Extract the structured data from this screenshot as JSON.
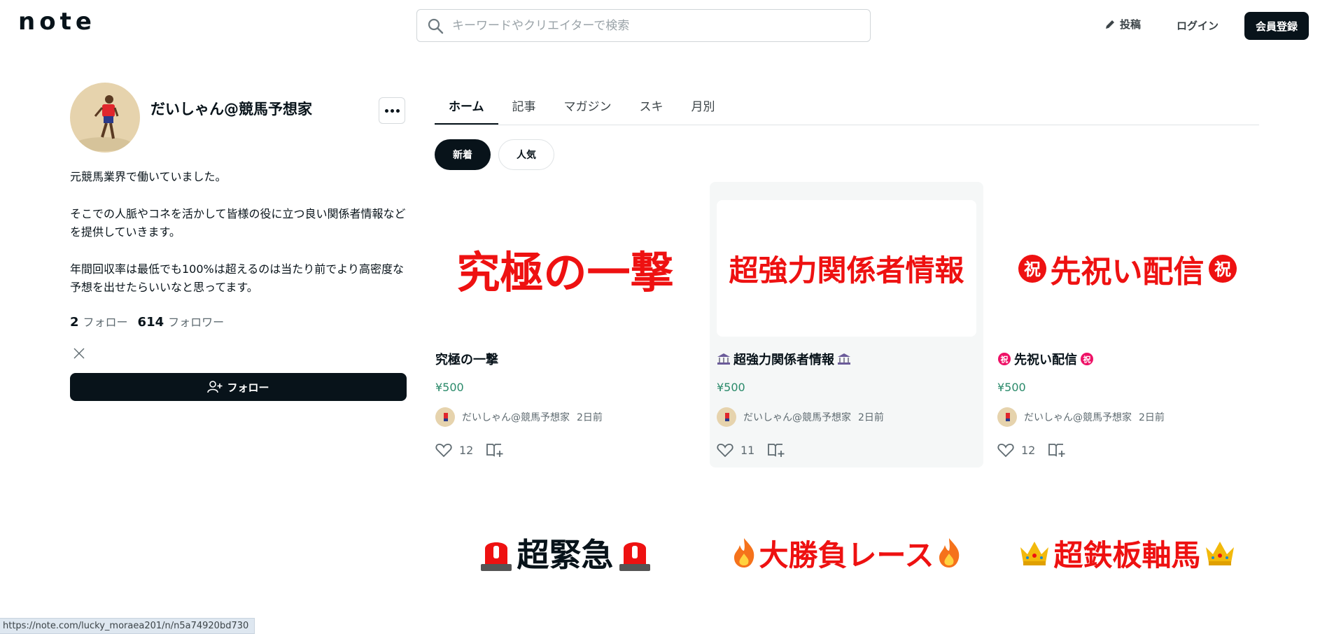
{
  "header": {
    "logo": "note",
    "search_placeholder": "キーワードやクリエイターで検索",
    "post_label": "投稿",
    "login_label": "ログイン",
    "signup_label": "会員登録"
  },
  "profile": {
    "name": "だいしゃん@競馬予想家",
    "bio": [
      "元競馬業界で働いていました。",
      "そこでの人脈やコネを活かして皆様の役に立つ良い関係者情報などを提供していきます。",
      "年間回収率は最低でも100%は超えるのは当たり前でより高密度な予想を出せたらいいなと思ってます。"
    ],
    "follow_count": "2",
    "follow_label": "フォロー",
    "follower_count": "614",
    "follower_label": "フォロワー",
    "follow_button": "フォロー"
  },
  "tabs": [
    "ホーム",
    "記事",
    "マガジン",
    "スキ",
    "月別"
  ],
  "sort": {
    "new": "新着",
    "popular": "人気"
  },
  "cards": [
    {
      "thumb": "究極の一撃",
      "title": "究極の一撃",
      "title_icon": "",
      "price": "¥500",
      "author": "だいしゃん@競馬予想家",
      "time": "2日前",
      "likes": "12"
    },
    {
      "thumb": "超強力関係者情報",
      "title": "超強力関係者情報",
      "title_icon": "bank-icon",
      "price": "¥500",
      "author": "だいしゃん@競馬予想家",
      "time": "2日前",
      "likes": "11"
    },
    {
      "thumb": "先祝い配信",
      "title": "先祝い配信",
      "title_icon": "celebration-icon",
      "price": "¥500",
      "author": "だいしゃん@競馬予想家",
      "time": "2日前",
      "likes": "12"
    }
  ],
  "row2": [
    {
      "thumb": "超緊急",
      "icon": "siren-icon"
    },
    {
      "thumb": "大勝負レース",
      "icon": "fire-icon"
    },
    {
      "thumb": "超鉄板軸馬",
      "icon": "crown-icon"
    }
  ],
  "status_url": "https://note.com/lucky_moraea201/n/n5a74920bd730",
  "colors": {
    "primary": "#08131a",
    "price": "#2a8a6a",
    "thumb_red": "#ee1111"
  }
}
